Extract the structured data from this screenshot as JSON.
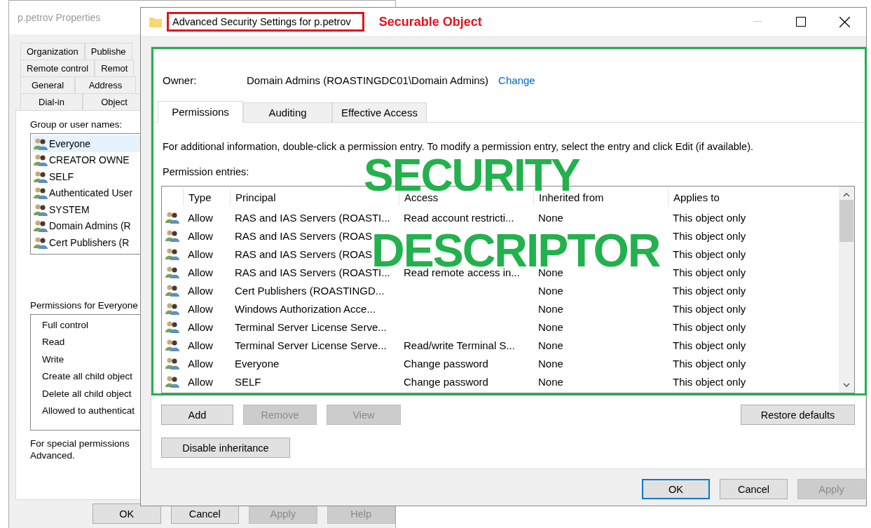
{
  "back_window": {
    "title": "p.petrov Properties",
    "tab_rows": [
      [
        {
          "label": "Organization",
          "selected": false
        },
        {
          "label": "Publishe",
          "selected": false
        }
      ],
      [
        {
          "label": "Remote control",
          "selected": false
        },
        {
          "label": "Remot",
          "selected": false
        }
      ],
      [
        {
          "label": "General",
          "selected": false
        },
        {
          "label": "Address",
          "selected": false
        }
      ],
      [
        {
          "label": "Dial-in",
          "selected": false
        },
        {
          "label": "Object",
          "selected": false
        }
      ]
    ],
    "groups_label": "Group or user names:",
    "groups": [
      {
        "name": "Everyone",
        "selected": true
      },
      {
        "name": "CREATOR OWNE",
        "selected": false
      },
      {
        "name": "SELF",
        "selected": false
      },
      {
        "name": "Authenticated User",
        "selected": false
      },
      {
        "name": "SYSTEM",
        "selected": false
      },
      {
        "name": "Domain Admins (R",
        "selected": false
      },
      {
        "name": "Cert Publishers (R",
        "selected": false
      }
    ],
    "permissions_label": "Permissions for Everyone",
    "permissions": [
      "Full control",
      "Read",
      "Write",
      "Create all child object",
      "Delete all child object",
      "Allowed to authenticat"
    ],
    "note_lines": [
      "For special permissions",
      "Advanced."
    ],
    "buttons": [
      {
        "label": "OK",
        "disabled": false
      },
      {
        "label": "Cancel",
        "disabled": false
      },
      {
        "label": "Apply",
        "disabled": true
      },
      {
        "label": "Help",
        "disabled": true
      }
    ]
  },
  "dialog": {
    "title": "Advanced Security Settings for p.petrov",
    "annotation_label": "Securable Object",
    "owner_label": "Owner:",
    "owner_value": "Domain Admins (ROASTINGDC01\\Domain Admins)",
    "owner_link": "Change",
    "tabs": [
      {
        "label": "Permissions",
        "selected": true
      },
      {
        "label": "Auditing",
        "selected": false
      },
      {
        "label": "Effective Access",
        "selected": false
      }
    ],
    "info": "For additional information, double-click a permission entry. To modify a permission entry, select the entry and click Edit (if available).",
    "entries_label": "Permission entries:",
    "columns": [
      "Type",
      "Principal",
      "Access",
      "Inherited from",
      "Applies to"
    ],
    "rows": [
      {
        "type": "Allow",
        "principal": "RAS and IAS Servers (ROASTI...",
        "access": "Read account restricti...",
        "inherited": "None",
        "applies": "This object only"
      },
      {
        "type": "Allow",
        "principal": "RAS and IAS Servers (ROAS",
        "applies": "This object only"
      },
      {
        "type": "Allow",
        "principal": "RAS and IAS Servers (ROAS",
        "applies": "This object only"
      },
      {
        "type": "Allow",
        "principal": "RAS and IAS Servers (ROASTI...",
        "access": "Read remote access in...",
        "inherited": "None",
        "applies": "This object only"
      },
      {
        "type": "Allow",
        "principal": "Cert Publishers (ROASTINGD...",
        "inherited": "None",
        "applies": "This object only"
      },
      {
        "type": "Allow",
        "principal": "Windows Authorization Acce...",
        "inherited": "None",
        "applies": "This object only"
      },
      {
        "type": "Allow",
        "principal": "Terminal Server License Serve...",
        "inherited": "None",
        "applies": "This object only"
      },
      {
        "type": "Allow",
        "principal": "Terminal Server License Serve...",
        "access": "Read/write Terminal S...",
        "inherited": "None",
        "applies": "This object only"
      },
      {
        "type": "Allow",
        "principal": "Everyone",
        "access": "Change password",
        "inherited": "None",
        "applies": "This object only"
      },
      {
        "type": "Allow",
        "principal": "SELF",
        "access": "Change password",
        "inherited": "None",
        "applies": "This object only"
      }
    ],
    "overlay_lines": [
      "SECURITY",
      "DESCRIPTOR"
    ],
    "action_buttons": [
      {
        "label": "Add",
        "disabled": false
      },
      {
        "label": "Remove",
        "disabled": true
      },
      {
        "label": "View",
        "disabled": true
      }
    ],
    "restore_button": "Restore defaults",
    "inheritance_button": "Disable inheritance",
    "footer_buttons": [
      {
        "label": "OK",
        "disabled": false,
        "default": true
      },
      {
        "label": "Cancel",
        "disabled": false,
        "default": false
      },
      {
        "label": "Apply",
        "disabled": true,
        "default": false
      }
    ]
  }
}
